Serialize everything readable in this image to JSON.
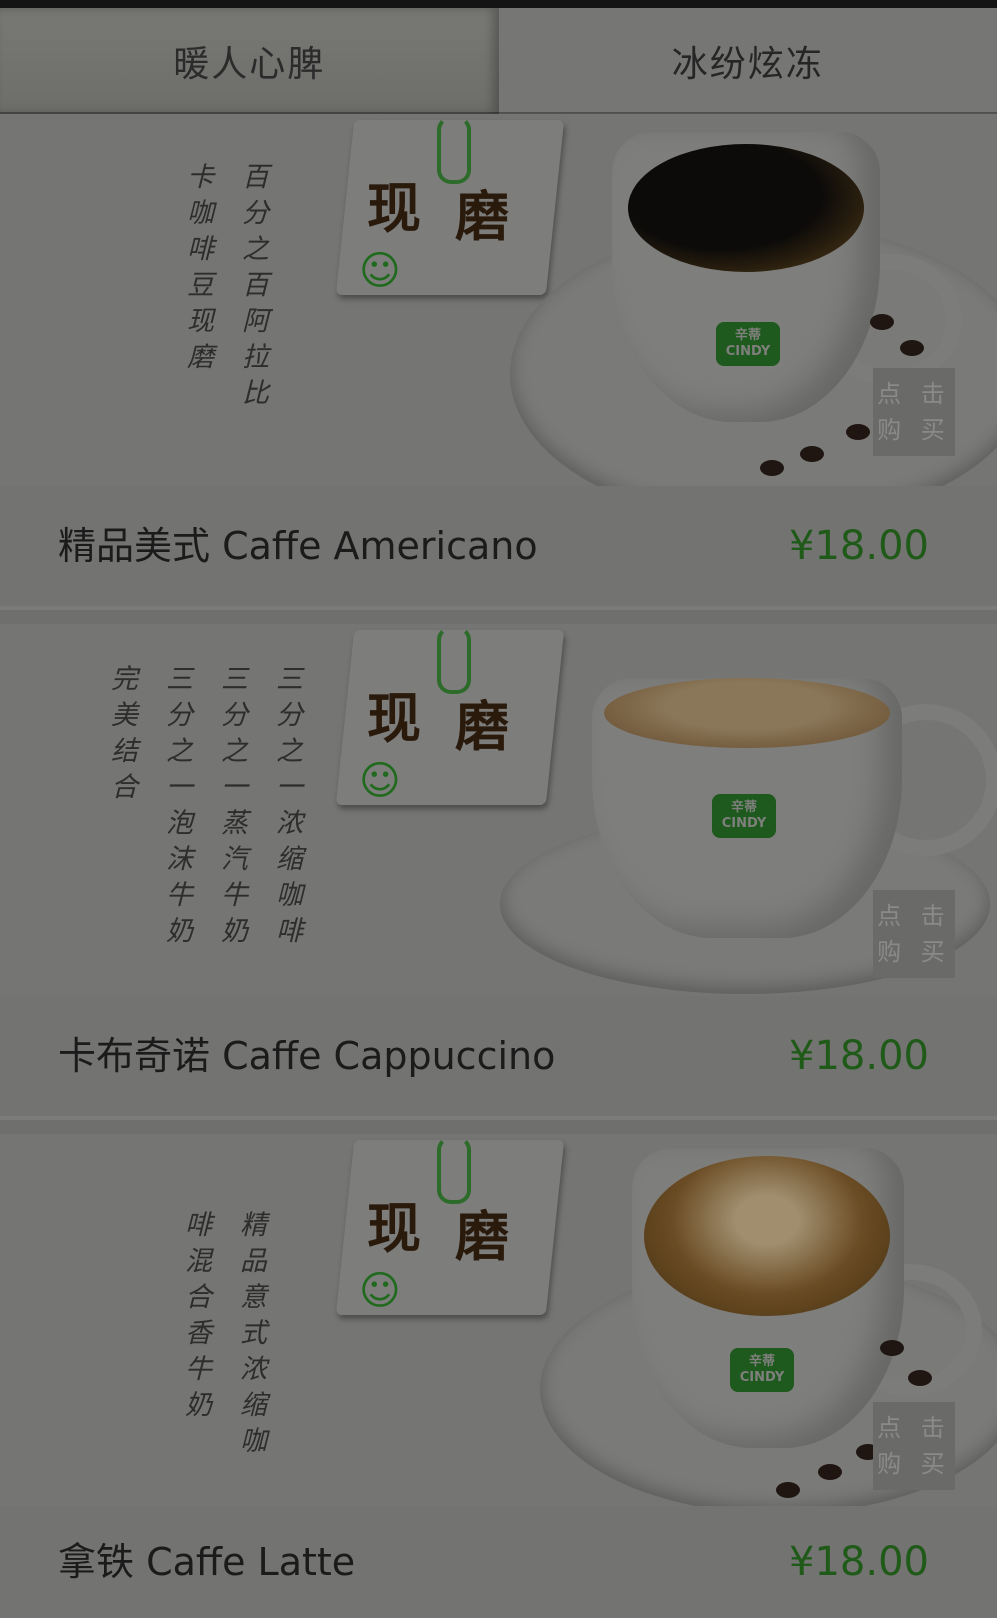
{
  "tabs": [
    {
      "label": "暖人心脾",
      "active": true
    },
    {
      "label": "冰纷炫冻",
      "active": false
    }
  ],
  "tag_words": [
    "现",
    "磨"
  ],
  "buy_label": [
    "点 击",
    "购 买"
  ],
  "logo_text": [
    "辛蒂",
    "CINDY"
  ],
  "products": [
    {
      "name": "精品美式  Caffe Americano",
      "price": "¥18.00",
      "poem": [
        "百分之百阿拉比",
        "卡咖啡豆现磨"
      ]
    },
    {
      "name": "卡布奇诺  Caffe Cappuccino",
      "price": "¥18.00",
      "poem": [
        "三分之一浓缩咖啡",
        "三分之一蒸汽牛奶",
        "三分之一泡沫牛奶",
        "完美结合"
      ]
    },
    {
      "name": "拿铁  Caffe Latte",
      "price": "¥18.00",
      "poem": [
        "精品意式浓缩咖",
        "啡混合香牛奶"
      ]
    }
  ],
  "colors": {
    "price": "#1f5a18",
    "overlay_bg": "#6f6f6d",
    "logo_green": "#1e5a1e"
  }
}
